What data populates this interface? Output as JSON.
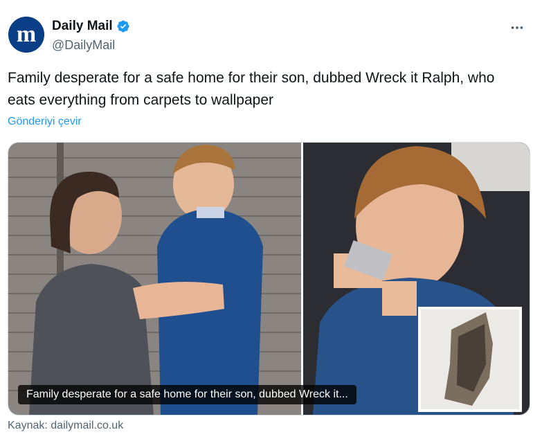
{
  "author": {
    "display_name": "Daily Mail",
    "handle": "@DailyMail",
    "avatar_letter": "m",
    "avatar_icon": "daily-mail-logo",
    "verified": true,
    "verified_icon": "verified-badge-icon",
    "more_icon": "more-options-icon"
  },
  "tweet": {
    "text": "Family desperate for a safe home for their son, dubbed Wreck it Ralph, who eats everything from carpets to wallpaper",
    "translate_label": "Gönderiyi çevir"
  },
  "media": {
    "caption": "Family desperate for a safe home for their son, dubbed Wreck it...",
    "images": [
      "mother-and-son-photo",
      "boy-chewing-photo",
      "damaged-wall-inset-photo"
    ]
  },
  "source": {
    "label": "Kaynak:",
    "domain": "dailymail.co.uk"
  },
  "colors": {
    "link": "#1d9bf0",
    "verified": "#1d9bf0",
    "muted": "#536471",
    "avatar_bg": "#0a3f88"
  }
}
